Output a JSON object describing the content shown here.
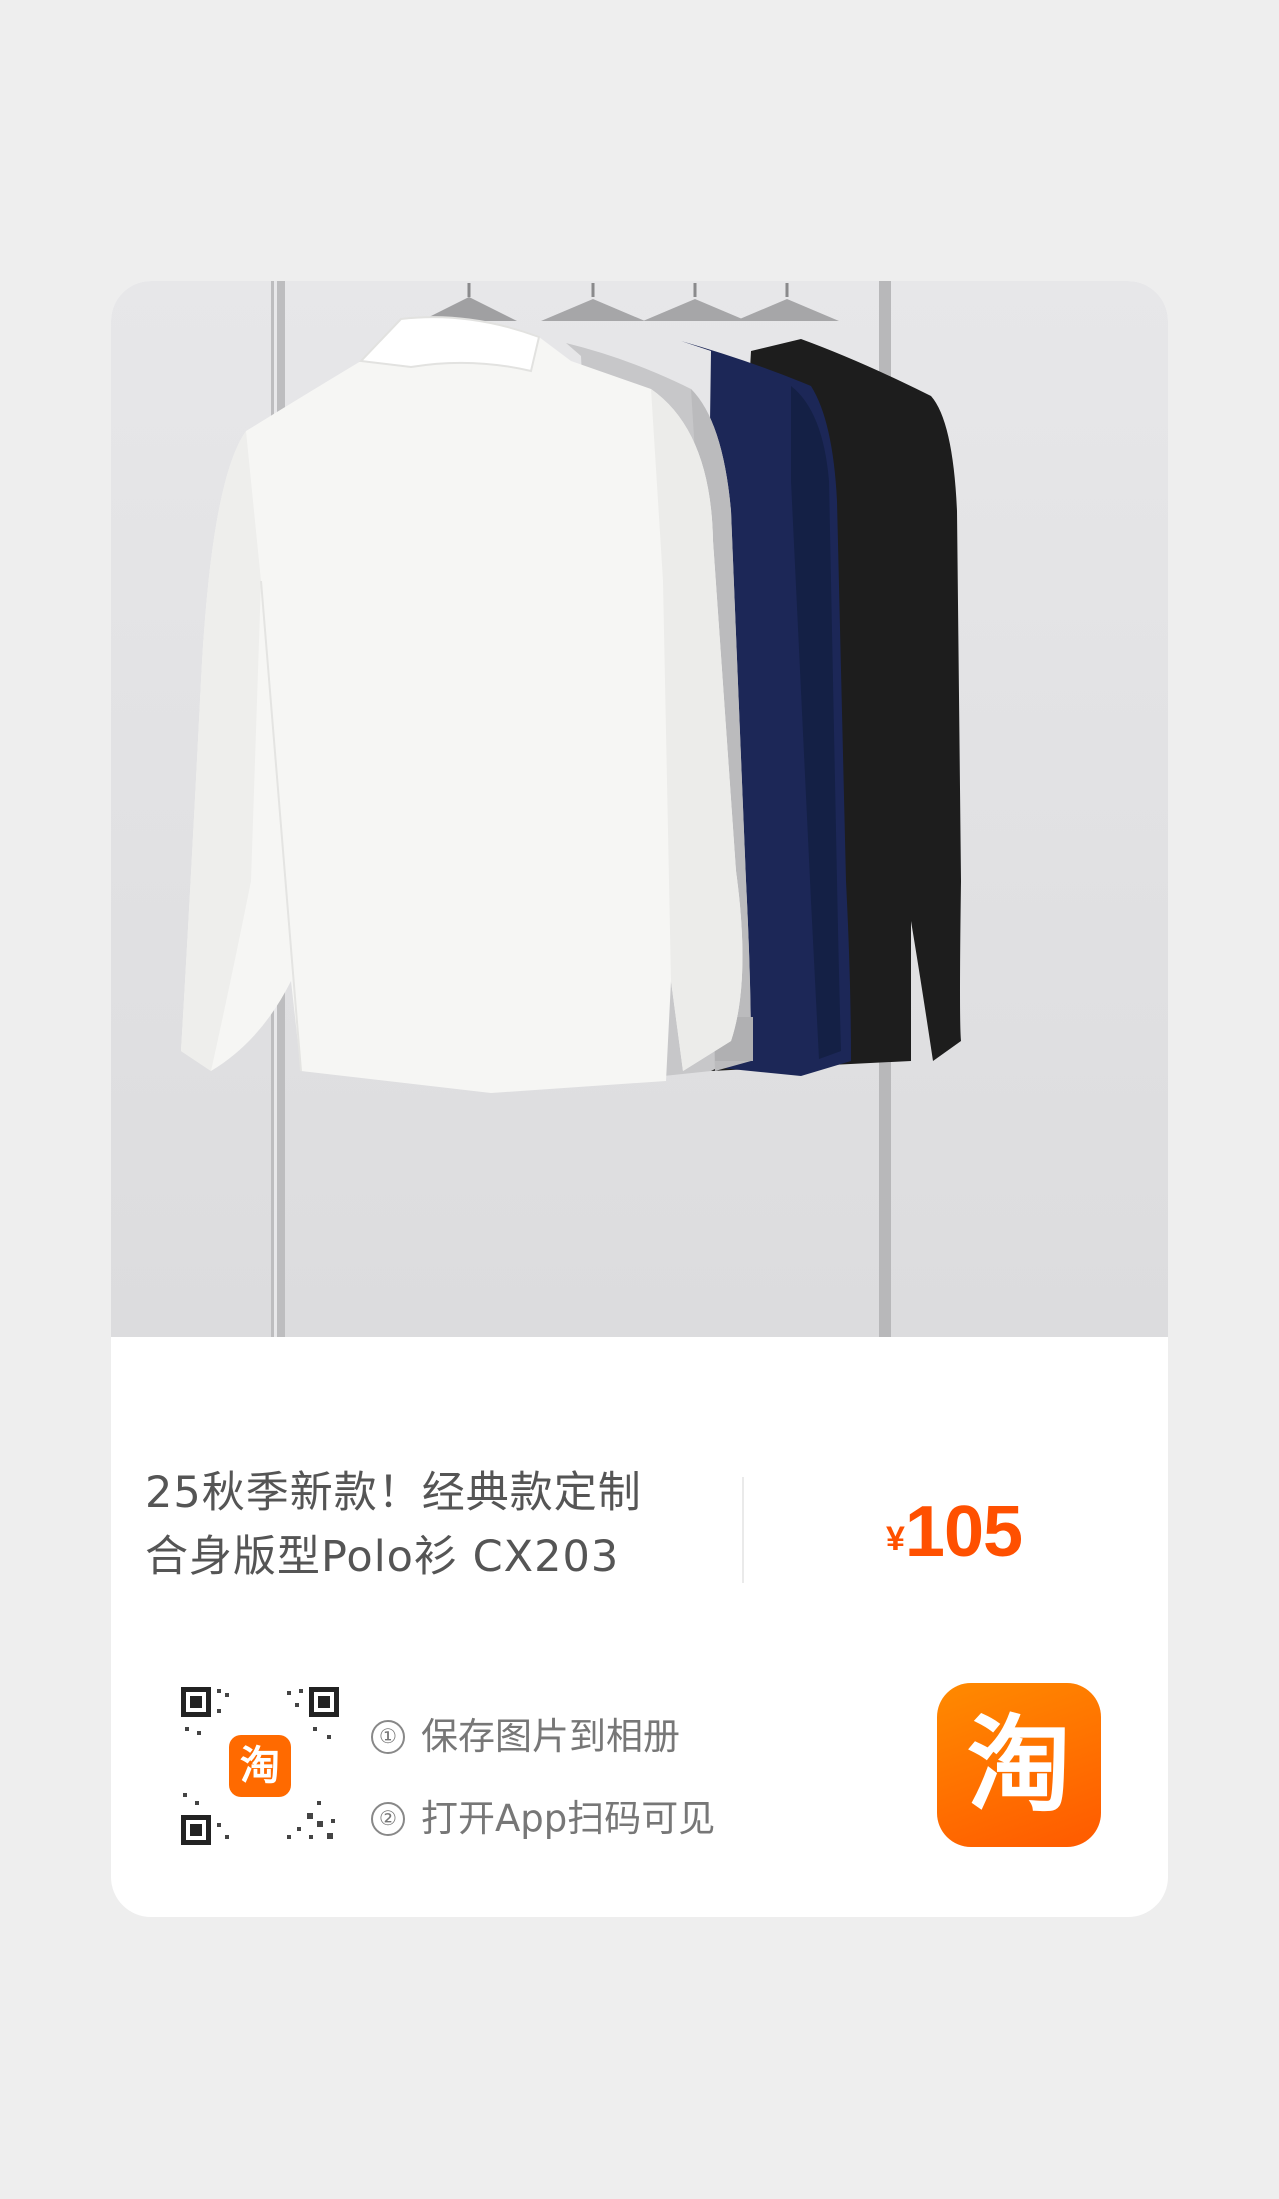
{
  "product": {
    "title_line1": "25秋季新款！经典款定制",
    "title_line2": "合身版型Polo衫 CX203",
    "currency": "¥",
    "price": "105"
  },
  "instructions": {
    "step1_num": "①",
    "step1_text": "保存图片到相册",
    "step2_num": "②",
    "step2_text": "打开App扫码可见"
  },
  "app": {
    "logo_char": "淘",
    "qr_badge_char": "淘",
    "icon": "taobao-logo-icon"
  },
  "colors": {
    "accent": "#ff5000",
    "logo_gradient_start": "#ff8a00",
    "logo_gradient_end": "#ff5a00",
    "shirt_white": "#f6f6f4",
    "shirt_grey": "#c7c7c9",
    "shirt_navy": "#1c2757",
    "shirt_black": "#1d1d1d"
  }
}
